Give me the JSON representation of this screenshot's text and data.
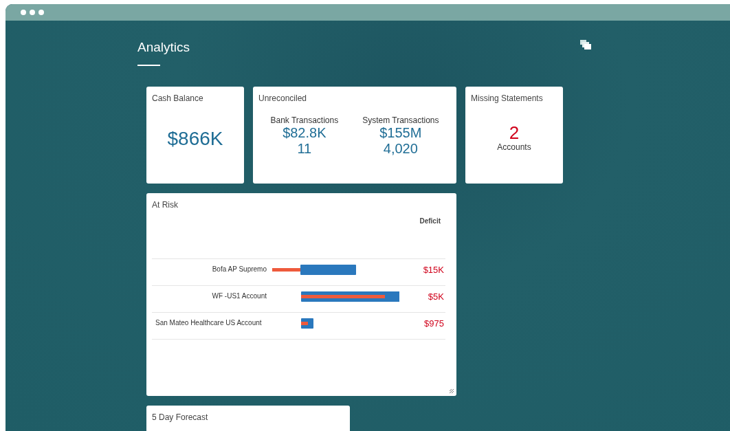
{
  "page": {
    "title": "Analytics"
  },
  "cash_balance": {
    "title": "Cash Balance",
    "value": "$866K"
  },
  "unreconciled": {
    "title": "Unreconciled",
    "columns": [
      {
        "label": "Bank Transactions",
        "amount": "$82.8K",
        "count": "11"
      },
      {
        "label": "System Transactions",
        "amount": "$155M",
        "count": "4,020"
      }
    ]
  },
  "missing_statements": {
    "title": "Missing Statements",
    "count": "2",
    "label": "Accounts"
  },
  "at_risk": {
    "title": "At Risk",
    "column_header": "Deficit",
    "rows": [
      {
        "name": "Bofa AP Supremo",
        "deficit": "$15K"
      },
      {
        "name": "WF -US1 Account",
        "deficit": "$5K"
      },
      {
        "name": "San Mateo Healthcare US Account",
        "deficit": "$975"
      }
    ]
  },
  "forecast": {
    "title": "5 Day Forecast"
  }
}
